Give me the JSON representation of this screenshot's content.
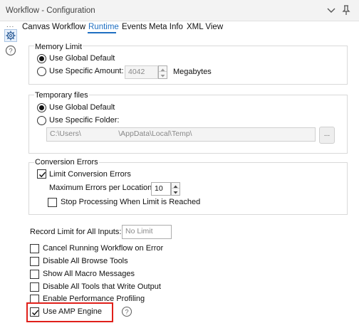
{
  "window": {
    "title": "Workflow - Configuration"
  },
  "sidebar": {
    "dots": "..."
  },
  "tabs": [
    "Canvas",
    "Workflow",
    "Runtime",
    "Events",
    "Meta Info",
    "XML View"
  ],
  "active_tab": "Runtime",
  "memory_limit": {
    "title": "Memory Limit",
    "option_global": "Use Global Default",
    "option_specific": "Use Specific Amount:",
    "amount_value": "4042",
    "unit": "Megabytes"
  },
  "temp_files": {
    "title": "Temporary files",
    "option_global": "Use Global Default",
    "option_specific": "Use Specific Folder:",
    "folder_value": "C:\\Users\\                  \\AppData\\Local\\Temp\\",
    "browse_label": "..."
  },
  "conversion_errors": {
    "title": "Conversion Errors",
    "limit_label": "Limit Conversion Errors",
    "max_errors_label": "Maximum Errors per Location:",
    "max_errors_value": "10",
    "stop_label": "Stop Processing When Limit is Reached"
  },
  "record_limit": {
    "label": "Record Limit for All Inputs:",
    "placeholder": "No Limit"
  },
  "options": [
    {
      "label": "Cancel Running Workflow on Error",
      "checked": false
    },
    {
      "label": "Disable All Browse Tools",
      "checked": false
    },
    {
      "label": "Show All Macro Messages",
      "checked": false
    },
    {
      "label": "Disable All Tools that Write Output",
      "checked": false
    },
    {
      "label": "Enable Performance Profiling",
      "checked": false
    },
    {
      "label": "Use AMP Engine",
      "checked": true
    }
  ],
  "colors": {
    "accent": "#1f6fc2",
    "highlight": "#e0201a"
  }
}
